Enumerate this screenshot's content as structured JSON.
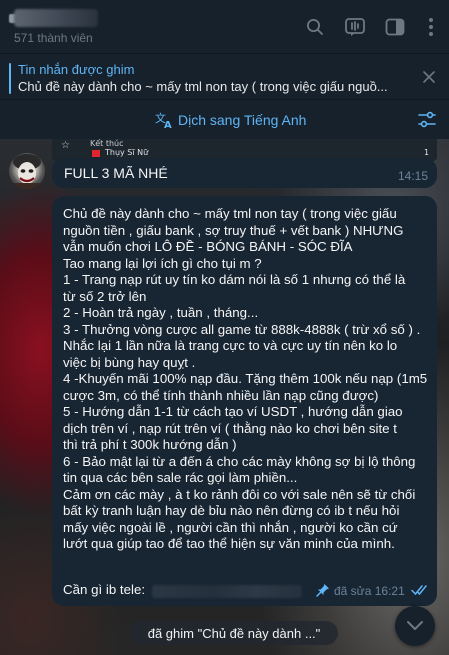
{
  "header": {
    "title": "",
    "subtitle": "571 thành viên",
    "icons": [
      "search-icon",
      "live-stream-icon",
      "sidebar-toggle-icon",
      "more-vertical-icon"
    ]
  },
  "pinned": {
    "title": "Tin nhắn được ghim",
    "text": "Chủ đề này dành cho ~ mấy tml non tay ( trong việc giấu nguồ..."
  },
  "translate": {
    "label": "Dịch sang Tiếng Anh"
  },
  "prev_media": {
    "status": "Kết thúc",
    "team": "Thụy Sĩ Nữ",
    "score": "1"
  },
  "messages": [
    {
      "text": "FULL 3 MÃ NHÉ",
      "time": "14:15"
    },
    {
      "lines": [
        "Chủ đề này dành cho ~ mấy tml non tay ( trong việc giấu",
        "nguồn tiền , giấu bank , sợ truy thuế + vết bank ) NHƯNG",
        "vẫn muốn chơi LÔ ĐỀ - BÓNG BÁNH - SÓC ĐĨA",
        "Tao mang lại lợi ích gì cho tụi m ?",
        "1 - Trang nạp rút uy tín ko dám nói là số 1 nhưng có thể là",
        "từ số 2 trở lên",
        "2 - Hoàn trả ngày , tuần , tháng...",
        "3 - Thưởng vòng cược all game từ 888k-4888k ( trừ xổ số ) .",
        "Nhắc lại 1 lần nữa là trang cực to và cực uy tín nên ko lo",
        "việc bị bùng hay quỵt .",
        "4 -Khuyến mãi 100% nạp đầu. Tặng thêm 100k nếu nạp (1m5",
        "cược 3m, có thể tính thành nhiều lần nạp cũng được)",
        "5 - Hướng dẫn 1-1 từ cách tạo ví USDT , hướng dẫn giao",
        "dịch trên ví , nạp rút trên ví ( thằng nào ko chơi bên site t",
        "thì trả phí t 300k hướng dẫn )",
        "6 - Bảo mật lại từ a đến á cho các mày không sợ bị lộ thông",
        "tin qua các bên sale rác gọi làm phiền...",
        "Cảm ơn các mày , à t ko rảnh đôi co với sale nên sẽ từ chối",
        "bất kỳ tranh luận hay dè bỉu nào nên đừng có ib t nếu hỏi",
        "mấy việc ngoài lề , người cần thì nhắn , người ko cần cứ",
        "lướt qua giúp tao để tao thể hiện sự văn minh của mình."
      ],
      "contact_label": "Cần gì ib tele:",
      "edited": "đã sửa 16:21"
    }
  ],
  "toast": "đã ghim \"Chủ đề này dành ...\"",
  "colors": {
    "accent": "#5eb5f7",
    "bubble": "#182533",
    "header_bg": "#17212b"
  }
}
